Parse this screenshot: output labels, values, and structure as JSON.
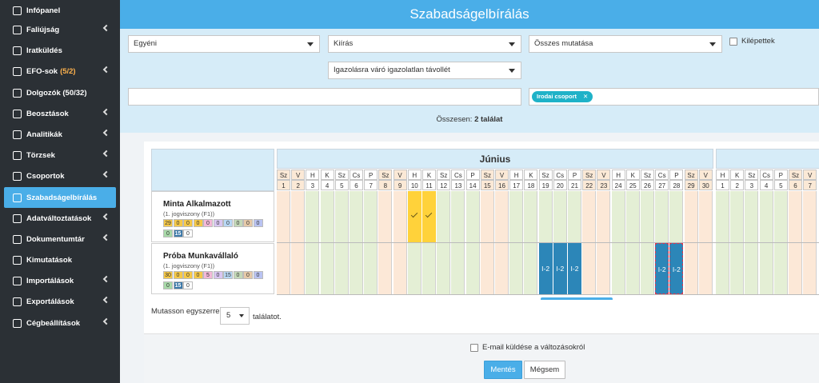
{
  "sidebar": {
    "items": [
      {
        "label": "Infópanel",
        "icon": "home-icon",
        "chevron": false
      },
      {
        "label": "Faliújság",
        "icon": "board-icon",
        "chevron": true
      },
      {
        "label": "Iratküldés",
        "icon": "send-icon",
        "chevron": false
      },
      {
        "label": "EFO-sok",
        "count": "(5/2)",
        "icon": "efo-icon",
        "chevron": true
      },
      {
        "label": "Dolgozók (50/32)",
        "icon": "users-icon",
        "chevron": false
      },
      {
        "label": "Beosztások",
        "icon": "calendar-icon",
        "chevron": true
      },
      {
        "label": "Analitikák",
        "icon": "chart-icon",
        "chevron": true
      },
      {
        "label": "Törzsek",
        "icon": "tree-icon",
        "chevron": true
      },
      {
        "label": "Csoportok",
        "icon": "group-icon",
        "chevron": true
      },
      {
        "label": "Szabadságelbírálás",
        "icon": "leave-icon",
        "chevron": false,
        "active": true
      },
      {
        "label": "Adatváltoztatások",
        "icon": "swap-icon",
        "chevron": true
      },
      {
        "label": "Dokumentumtár",
        "icon": "folder-icon",
        "chevron": true
      },
      {
        "label": "Kimutatások",
        "icon": "report-icon",
        "chevron": false
      },
      {
        "label": "Importálások",
        "icon": "import-icon",
        "chevron": true
      },
      {
        "label": "Exportálások",
        "icon": "export-icon",
        "chevron": true
      },
      {
        "label": "Cégbeállítások",
        "icon": "settings-icon",
        "chevron": true
      }
    ]
  },
  "header": {
    "title": "Szabadságelbírálás"
  },
  "filters": {
    "mode": "Egyéni",
    "type": "Kiírás",
    "show": "Összes mutatása",
    "left_label": "Kilépettek",
    "status": "Igazolásra váró igazolatlan távollét",
    "group_tag": "Irodai csoport",
    "total_prefix": "Összesen:",
    "total_value": "2 találat"
  },
  "calendar": {
    "month": "Június",
    "days": [
      {
        "d": "Sz",
        "n": "1",
        "we": true
      },
      {
        "d": "V",
        "n": "2",
        "we": true
      },
      {
        "d": "H",
        "n": "3"
      },
      {
        "d": "K",
        "n": "4"
      },
      {
        "d": "Sz",
        "n": "5"
      },
      {
        "d": "Cs",
        "n": "6"
      },
      {
        "d": "P",
        "n": "7"
      },
      {
        "d": "Sz",
        "n": "8",
        "we": true
      },
      {
        "d": "V",
        "n": "9",
        "we": true
      },
      {
        "d": "H",
        "n": "10"
      },
      {
        "d": "K",
        "n": "11"
      },
      {
        "d": "Sz",
        "n": "12"
      },
      {
        "d": "Cs",
        "n": "13"
      },
      {
        "d": "P",
        "n": "14"
      },
      {
        "d": "Sz",
        "n": "15",
        "we": true
      },
      {
        "d": "V",
        "n": "16",
        "we": true
      },
      {
        "d": "H",
        "n": "17"
      },
      {
        "d": "K",
        "n": "18"
      },
      {
        "d": "Sz",
        "n": "19"
      },
      {
        "d": "Cs",
        "n": "20"
      },
      {
        "d": "P",
        "n": "21"
      },
      {
        "d": "Sz",
        "n": "22",
        "we": true
      },
      {
        "d": "V",
        "n": "23",
        "we": true
      },
      {
        "d": "H",
        "n": "24"
      },
      {
        "d": "K",
        "n": "25"
      },
      {
        "d": "Sz",
        "n": "26"
      },
      {
        "d": "Cs",
        "n": "27"
      },
      {
        "d": "P",
        "n": "28"
      },
      {
        "d": "Sz",
        "n": "29",
        "we": true
      },
      {
        "d": "V",
        "n": "30",
        "we": true
      }
    ],
    "next_days": [
      {
        "d": "H",
        "n": "1"
      },
      {
        "d": "K",
        "n": "2"
      },
      {
        "d": "Sz",
        "n": "3"
      },
      {
        "d": "Cs",
        "n": "4"
      },
      {
        "d": "P",
        "n": "5"
      },
      {
        "d": "Sz",
        "n": "6",
        "we": true
      },
      {
        "d": "V",
        "n": "7",
        "we": true
      }
    ]
  },
  "employees": [
    {
      "name": "Minta Alkalmazott",
      "sub": "(1. jogviszony (F1))",
      "chips_row1": [
        {
          "v": "29",
          "c": "#f6c948"
        },
        {
          "v": "0",
          "c": "#f6c948"
        },
        {
          "v": "0",
          "c": "#f6c948"
        },
        {
          "v": "0",
          "c": "#f6c948"
        },
        {
          "v": "0",
          "c": "#f3b8d8"
        },
        {
          "v": "0",
          "c": "#d9c6f2"
        },
        {
          "v": "0",
          "c": "#b8d8f5"
        },
        {
          "v": "0",
          "c": "#c4d9b8"
        },
        {
          "v": "0",
          "c": "#e6c9a8"
        },
        {
          "v": "0",
          "c": "#b9c3f2"
        }
      ],
      "chips_row2": [
        {
          "v": "0",
          "c": "#a8d9a8"
        },
        {
          "v": "15",
          "c": "#3b78a8",
          "dark": true
        },
        {
          "v": "0",
          "c": "#ffffff"
        }
      ],
      "absent_days": [
        "10",
        "11"
      ],
      "leave": [],
      "pending": []
    },
    {
      "name": "Próba Munkavállaló",
      "sub": "(1. jogviszony (F1))",
      "chips_row1": [
        {
          "v": "30",
          "c": "#f6c948"
        },
        {
          "v": "0",
          "c": "#f6c948"
        },
        {
          "v": "0",
          "c": "#f6c948"
        },
        {
          "v": "0",
          "c": "#f6c948"
        },
        {
          "v": "5",
          "c": "#f3b8d8"
        },
        {
          "v": "0",
          "c": "#d9c6f2"
        },
        {
          "v": "15",
          "c": "#b8d8f5"
        },
        {
          "v": "0",
          "c": "#c4d9b8"
        },
        {
          "v": "0",
          "c": "#e6c9a8"
        },
        {
          "v": "0",
          "c": "#b9c3f2"
        }
      ],
      "chips_row2": [
        {
          "v": "0",
          "c": "#a8d9a8"
        },
        {
          "v": "15",
          "c": "#3b78a8",
          "dark": true
        },
        {
          "v": "0",
          "c": "#ffffff"
        }
      ],
      "absent_days": [],
      "leave": [
        {
          "day": "19",
          "label": "I-2"
        },
        {
          "day": "20",
          "label": "I-2"
        },
        {
          "day": "21",
          "label": "I-2"
        },
        {
          "day": "27",
          "label": "I-2"
        },
        {
          "day": "28",
          "label": "I-2"
        }
      ],
      "pending": [
        "27",
        "28"
      ]
    }
  ],
  "pager": {
    "prefix": "Mutasson egyszerre",
    "value": "5",
    "suffix": "találatot."
  },
  "footer": {
    "email_label": "E-mail küldése a változásokról",
    "save": "Mentés",
    "cancel": "Mégsem"
  },
  "colors": {
    "accent": "#4aaee8",
    "sidebar": "#2b3035",
    "absent": "#ffd23a",
    "leave": "#2c86b8"
  }
}
